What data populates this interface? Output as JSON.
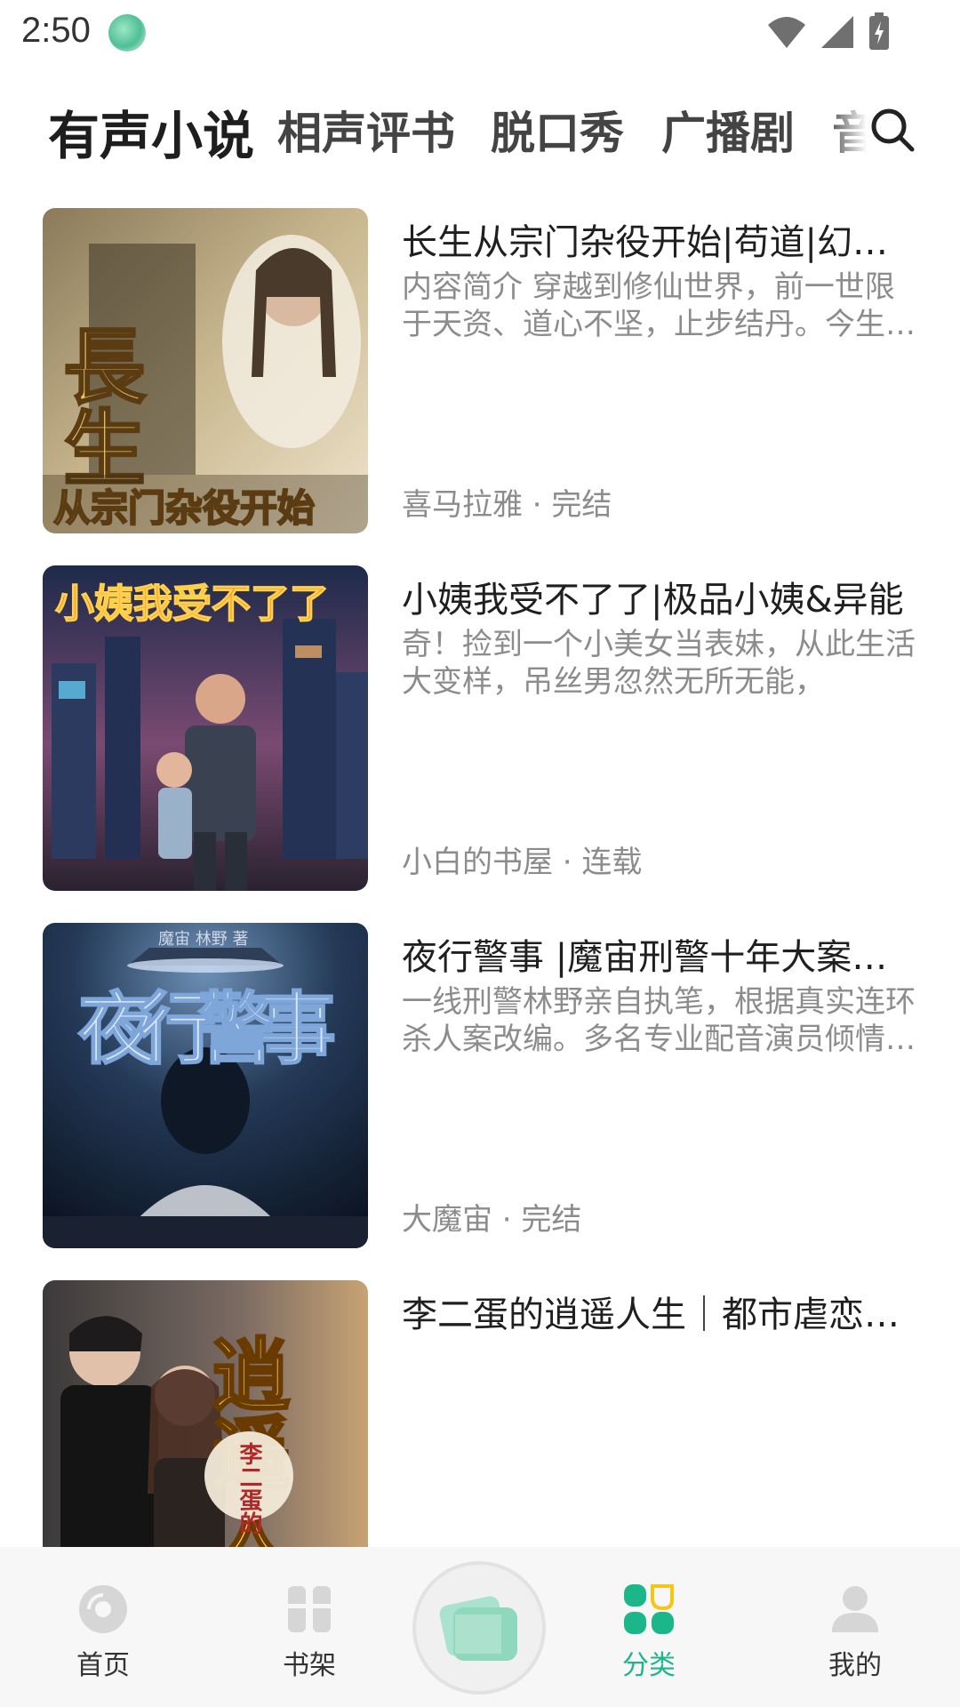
{
  "status_bar": {
    "time": "2:50",
    "icons": [
      "wifi-icon",
      "signal-icon",
      "battery-charging-icon"
    ]
  },
  "top_tabs": {
    "items": [
      {
        "label": "有声小说",
        "active": true
      },
      {
        "label": "相声评书",
        "active": false
      },
      {
        "label": "脱口秀",
        "active": false
      },
      {
        "label": "广播剧",
        "active": false
      },
      {
        "label": "音",
        "active": false
      }
    ],
    "search_icon": "search-icon"
  },
  "books": [
    {
      "title": "长生从宗门杂役开始|苟道|幻想|修仙|穿越",
      "description": "内容简介 穿越到修仙世界，前一世限于天资、道心不坚，止步结丹。今生重来",
      "source": "喜马拉雅",
      "status": "完结",
      "meta": "喜马拉雅 · 完结",
      "cover_text": "長生",
      "cover_subtitle": "从宗门杂役开始"
    },
    {
      "title": "小姨我受不了了|极品小姨&异能",
      "description": "奇！捡到一个小美女当表妹，从此生活大变样，吊丝男忽然无所无能，",
      "source": "小白的书屋",
      "status": "连载",
      "meta": "小白的书屋 · 连载",
      "cover_text": "小姨我受不了了"
    },
    {
      "title": "夜行警事 |魔宙刑警十年大案实录",
      "description": "一线刑警林野亲自执笔，根据真实连环杀人案改编。多名专业配音演员倾情演绎",
      "source": "大魔宙",
      "status": "完结",
      "meta": "大魔宙 · 完结",
      "cover_text": "夜行警事",
      "cover_header": "魔宙 林野 著"
    },
    {
      "title": "李二蛋的逍遥人生｜都市虐恋｜豪门",
      "description": "",
      "meta": "",
      "cover_text": "逍遥人生",
      "cover_badge": "李二蛋的"
    }
  ],
  "bottom_nav": {
    "items": [
      {
        "label": "首页",
        "icon": "disc-icon",
        "active": false
      },
      {
        "label": "书架",
        "icon": "bookshelf-icon",
        "active": false
      },
      {
        "label": "分类",
        "icon": "category-grid-icon",
        "active": true
      },
      {
        "label": "我的",
        "icon": "profile-icon",
        "active": false
      }
    ],
    "center_button_icon": "now-playing-icon"
  },
  "colors": {
    "accent": "#1bb68a",
    "text_primary": "#1f1f1f",
    "text_secondary": "#8c8c8c",
    "nav_background": "#f7f7f7"
  }
}
